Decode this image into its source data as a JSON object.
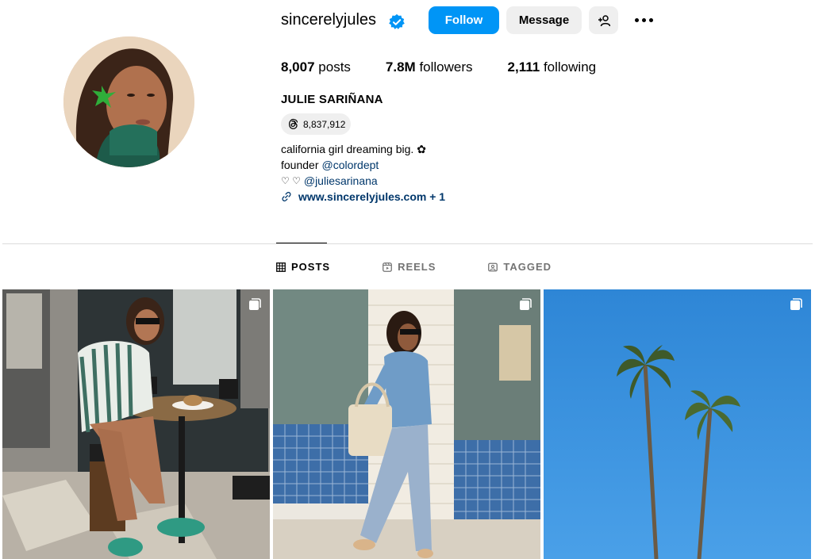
{
  "profile": {
    "username": "sincerelyjules",
    "full_name": "JULIE SARIÑANA",
    "threads_count": "8,837,912"
  },
  "actions": {
    "follow": "Follow",
    "message": "Message"
  },
  "stats": {
    "posts_value": "8,007",
    "posts_label": "posts",
    "followers_value": "7.8M",
    "followers_label": "followers",
    "following_value": "2,111",
    "following_label": "following"
  },
  "bio": {
    "line1": "california girl dreaming big. ✿",
    "line2_prefix": "founder",
    "line2_mention": "@colordept",
    "line3_prefix": "♡ ♡",
    "line3_mention": "@juliesarinana",
    "website": "www.sincerelyjules.com + 1"
  },
  "tabs": [
    {
      "label": "POSTS",
      "icon": "grid-icon"
    },
    {
      "label": "REELS",
      "icon": "reels-icon"
    },
    {
      "label": "TAGGED",
      "icon": "tagged-icon"
    }
  ],
  "colors": {
    "follow_button": "#0095f6",
    "secondary_button": "#efefef",
    "link": "#00376b",
    "verified_badge": "#0095f6"
  },
  "posts": [
    {
      "description_icon": "carousel-icon"
    },
    {
      "description_icon": "carousel-icon"
    },
    {
      "description_icon": "carousel-icon"
    }
  ]
}
